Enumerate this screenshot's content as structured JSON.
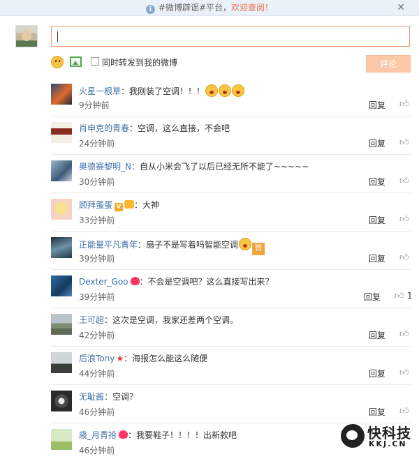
{
  "notice": {
    "prefix": "#微博辟谣#平台，",
    "link": "欢迎查阅！"
  },
  "composer": {
    "input_value": "",
    "repost_label": "同时转发到我的微博",
    "submit_label": "评论"
  },
  "comments": [
    {
      "user": "火星一根草",
      "text": "我刚装了空调！！！",
      "time": "9分钟前",
      "reply": "回复",
      "likes": ""
    },
    {
      "user": "肖申克的青春",
      "text": "空调，这么直接，不会吧",
      "time": "24分钟前",
      "reply": "回复",
      "likes": ""
    },
    {
      "user": "奥德赛黎明_N",
      "text": "自从小米会飞了以后已经无所不能了~~~~~",
      "time": "30分钟前",
      "reply": "回复",
      "likes": ""
    },
    {
      "user": "顾拜蛋蛋",
      "text": "大神",
      "time": "33分钟前",
      "reply": "回复",
      "likes": ""
    },
    {
      "user": "正能量平凡青年",
      "text": "扇子不是写着吗智能空调",
      "time": "39分钟前",
      "reply": "回复",
      "likes": ""
    },
    {
      "user": "Dexter_Goo",
      "text": "不会是空调吧？这么直接写出来？",
      "time": "39分钟前",
      "reply": "回复",
      "likes": "1"
    },
    {
      "user": "王可超",
      "text": "这次是空调，我家还差两个空调。",
      "time": "42分钟前",
      "reply": "回复",
      "likes": ""
    },
    {
      "user": "后浪Tony",
      "text": "海报怎么能这么随便",
      "time": "44分钟前",
      "reply": "回复",
      "likes": ""
    },
    {
      "user": "无耻酱",
      "text": "空调？",
      "time": "46分钟前",
      "reply": "回复",
      "likes": ""
    },
    {
      "user": "歳_月青拾",
      "text": "我要鞋子！！！！出新款吧",
      "time": "46分钟前",
      "reply": "回复",
      "likes": ""
    }
  ],
  "watermark": {
    "name": "快科技",
    "site": "KKJ.CN"
  }
}
